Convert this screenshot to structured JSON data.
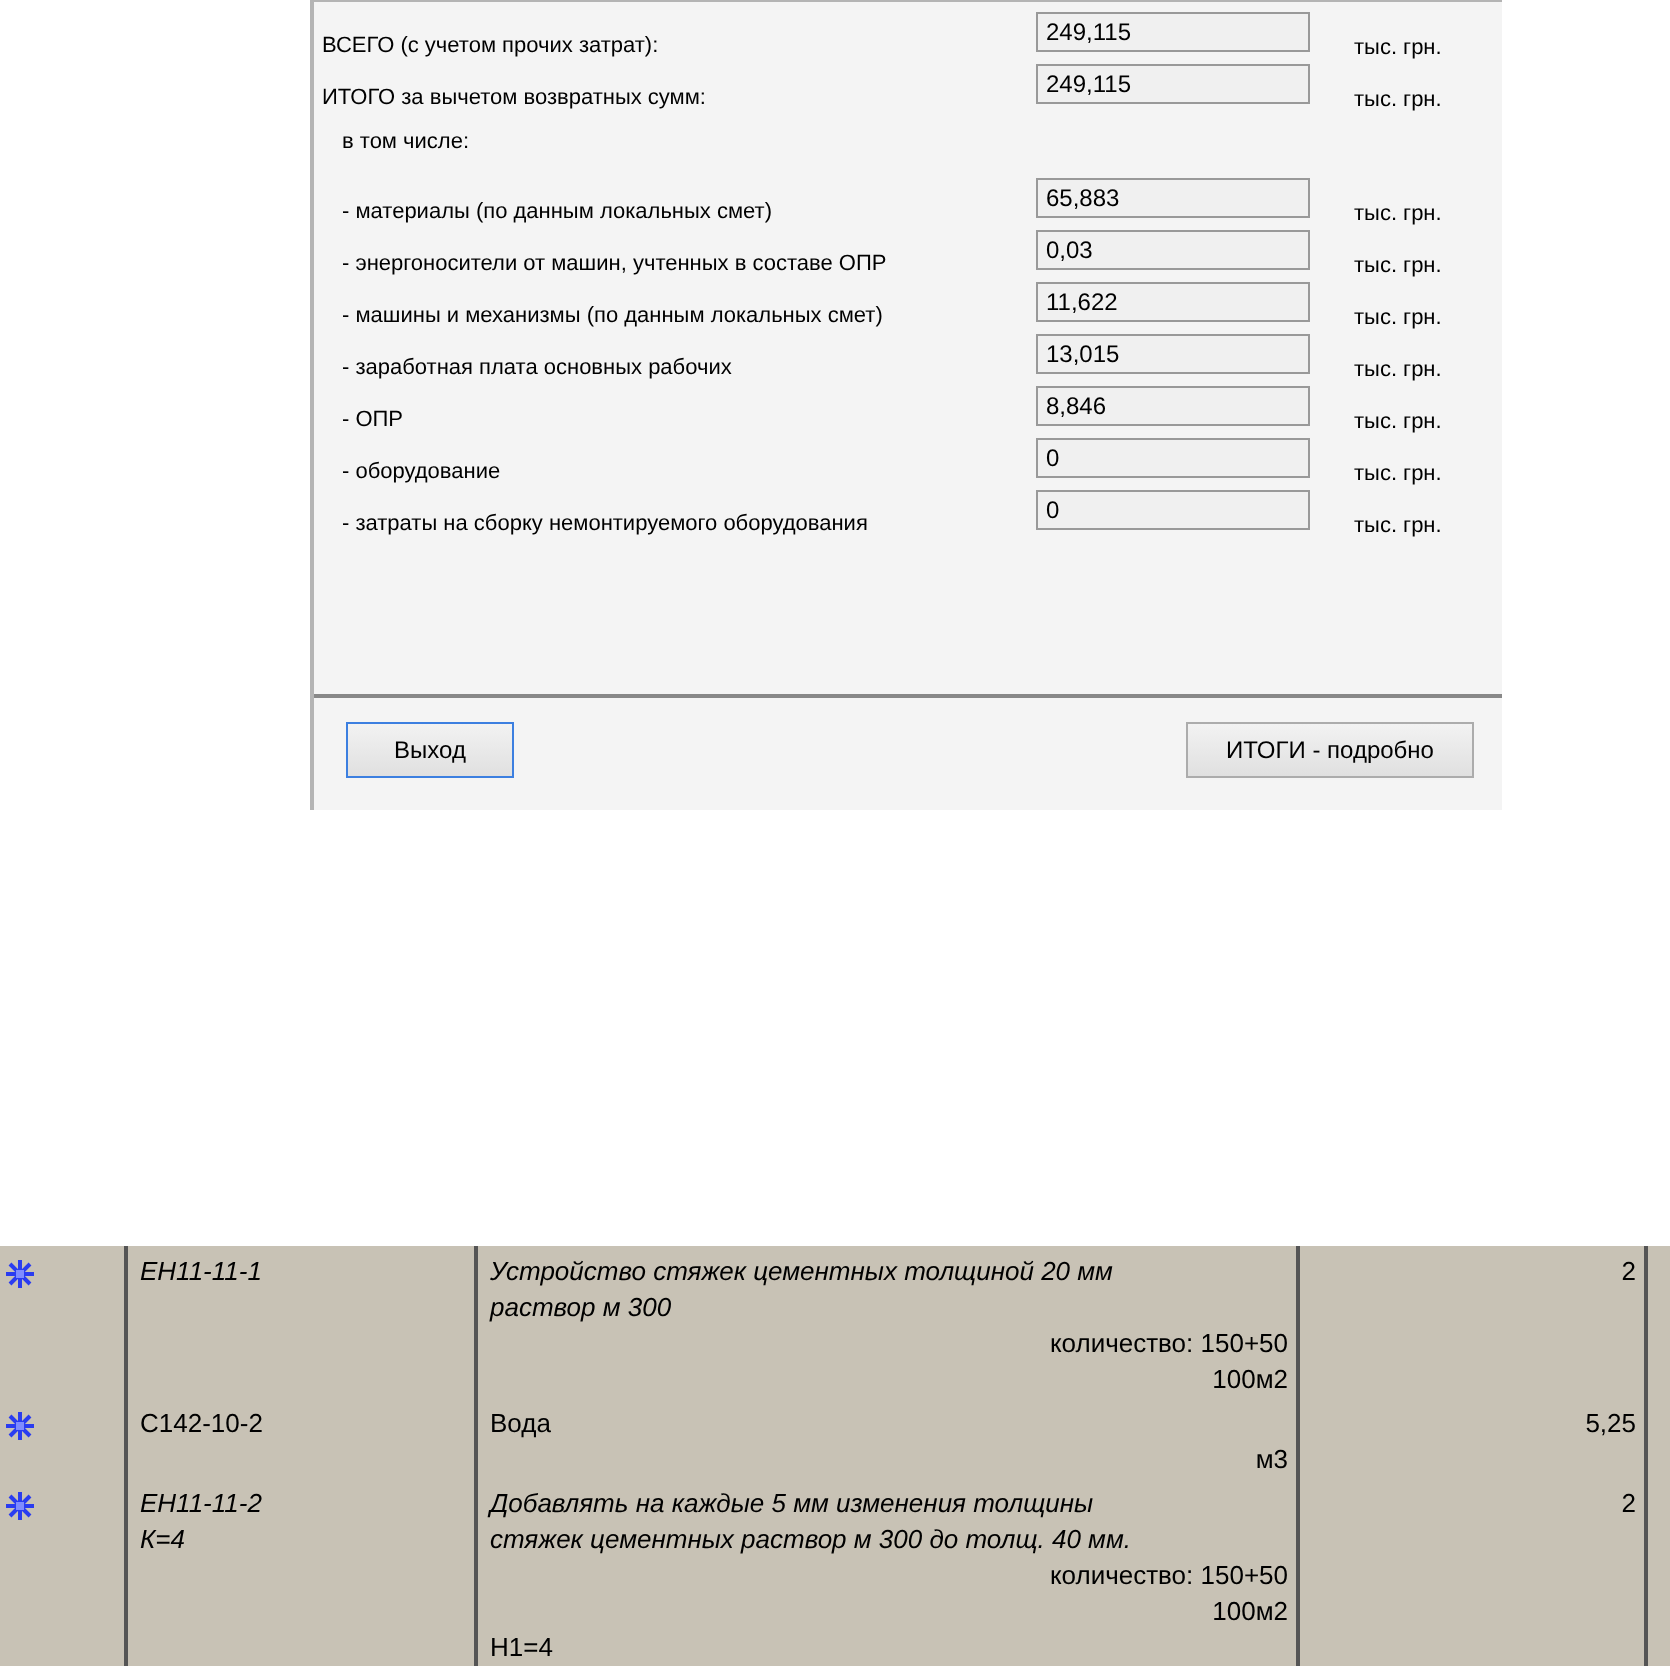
{
  "totals": [
    {
      "label": "ВСЕГО (с учетом прочих затрат):",
      "value": "249,115",
      "unit": "тыс. грн."
    },
    {
      "label": "ИТОГО за вычетом возвратных сумм:",
      "value": "249,115",
      "unit": "тыс. грн."
    }
  ],
  "breakdown_heading": "в том числе:",
  "breakdown": [
    {
      "label": "- материалы (по данным локальных смет)",
      "value": "65,883",
      "unit": "тыс. грн."
    },
    {
      "label": "- энергоносители от машин, учтенных в составе ОПР",
      "value": "0,03",
      "unit": "тыс. грн."
    },
    {
      "label": "- машины и механизмы (по данным локальных смет)",
      "value": "11,622",
      "unit": "тыс. грн."
    },
    {
      "label": "- заработная плата основных рабочих",
      "value": "13,015",
      "unit": "тыс. грн."
    },
    {
      "label": "- ОПР",
      "value": "8,846",
      "unit": "тыс. грн."
    },
    {
      "label": "- оборудование",
      "value": "0",
      "unit": "тыс. грн."
    },
    {
      "label": "- затраты на сборку немонтируемого оборудования",
      "value": "0",
      "unit": "тыс. грн."
    }
  ],
  "buttons": [
    {
      "label": "Выход",
      "focused": true
    },
    {
      "label": "ИТОГИ - подробно",
      "focused": false
    }
  ],
  "estimate_rows": [
    {
      "italic": true,
      "code_lines": [
        "ЕН11-11-1"
      ],
      "description_lines": [
        "Устройство стяжек цементных толщиной 20 мм",
        "раствор м 300"
      ],
      "quantity": "количество: 150+50",
      "unit": "100м2",
      "value": "2"
    },
    {
      "italic": false,
      "code_lines": [
        "С142-10-2"
      ],
      "description_lines": [
        "Вода"
      ],
      "unit": "м3",
      "value": "5,25"
    },
    {
      "italic": true,
      "code_lines": [
        "ЕН11-11-2",
        "К=4"
      ],
      "description_lines": [
        "Добавлять на каждые 5 мм изменения толщины",
        "стяжек цементных раствор м 300 до толщ. 40 мм."
      ],
      "quantity": "количество: 150+50",
      "unit": "100м2",
      "note": "Н1=4",
      "value": "2"
    }
  ]
}
